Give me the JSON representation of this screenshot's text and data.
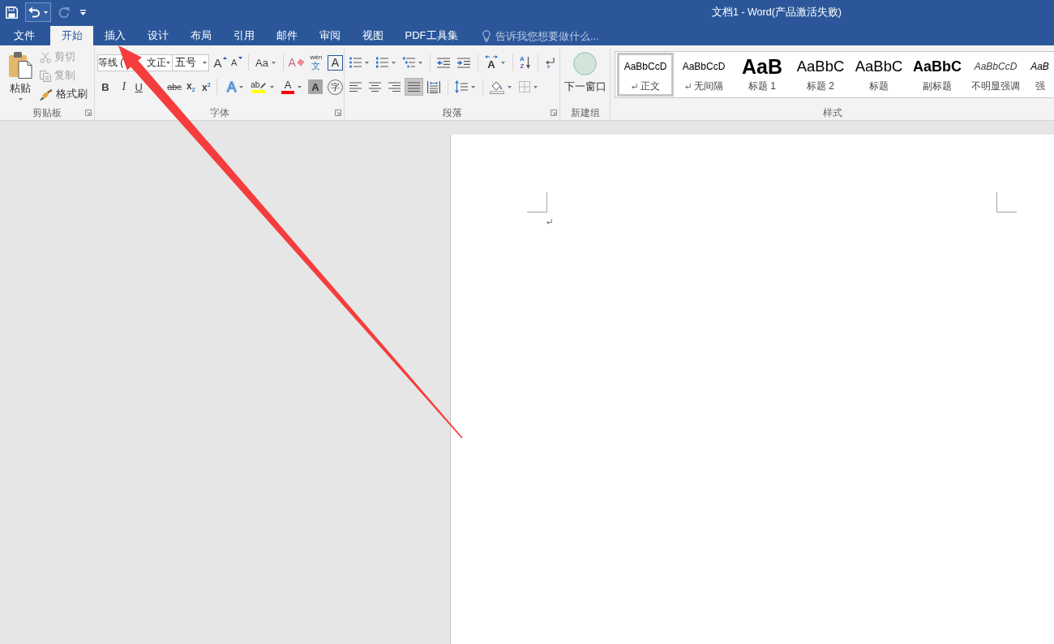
{
  "title_bar": {
    "title": "文档1 - Word(产品激活失败)",
    "quick_access": [
      {
        "kind": "save",
        "disabled": false,
        "highlighted": false,
        "dropdown": false
      },
      {
        "kind": "undo",
        "disabled": false,
        "highlighted": true,
        "dropdown": true
      },
      {
        "kind": "redo",
        "disabled": true,
        "highlighted": false,
        "dropdown": false
      },
      {
        "kind": "customize",
        "disabled": false,
        "highlighted": false,
        "dropdown": false
      }
    ]
  },
  "tabs": [
    {
      "label": "文件",
      "selected": false
    },
    {
      "label": "开始",
      "selected": true
    },
    {
      "label": "插入",
      "selected": false
    },
    {
      "label": "设计",
      "selected": false
    },
    {
      "label": "布局",
      "selected": false
    },
    {
      "label": "引用",
      "selected": false
    },
    {
      "label": "邮件",
      "selected": false
    },
    {
      "label": "审阅",
      "selected": false
    },
    {
      "label": "视图",
      "selected": false
    },
    {
      "label": "PDF工具集",
      "selected": false
    }
  ],
  "tell_me": {
    "placeholder": "告诉我您想要做什么..."
  },
  "ribbon": {
    "clipboard": {
      "label": "剪贴板",
      "launcher": true,
      "paste": {
        "label": "粘贴",
        "dropdown": true
      },
      "items": [
        {
          "kind": "cut",
          "label": "剪切",
          "disabled": true
        },
        {
          "kind": "copy",
          "label": "复制",
          "disabled": true
        },
        {
          "kind": "format_painter",
          "label": "格式刷",
          "disabled": false
        }
      ]
    },
    "font": {
      "label": "字体",
      "launcher": true,
      "font_name": {
        "value_parts": [
          "等线 (",
          "文正"
        ]
      },
      "font_size": {
        "value": "五号"
      },
      "row1": [
        [
          {
            "kind": "grow",
            "glyph": "A",
            "dropdown": false
          },
          {
            "kind": "shrink",
            "glyph": "A",
            "dropdown": false
          }
        ],
        [
          {
            "kind": "case",
            "glyph": "Aa",
            "dropdown": true
          }
        ],
        [
          {
            "kind": "clear",
            "glyph": "A",
            "dropdown": false
          },
          {
            "kind": "phonetic",
            "glyph": "wén",
            "glyph2": "文",
            "dropdown": false
          },
          {
            "kind": "border",
            "glyph": "A",
            "dropdown": false
          }
        ]
      ],
      "row2": [
        [
          {
            "kind": "bold",
            "glyph": "B",
            "dropdown": false
          },
          {
            "kind": "italic",
            "glyph": "I",
            "dropdown": false
          },
          {
            "kind": "underline",
            "glyph": "U",
            "dropdown": false
          },
          {
            "kind": "strikethrough",
            "glyph": "abc",
            "dropdown": false
          },
          {
            "kind": "subscript",
            "glyph": "x$_{2}$",
            "dropdown": false
          },
          {
            "kind": "superscript",
            "glyph": "x$^{2}$",
            "dropdown": false
          }
        ],
        [
          {
            "kind": "effects",
            "glyph": "A",
            "dropdown": true
          },
          {
            "kind": "highlight",
            "glyph": "ab",
            "color": "#ffff00",
            "dropdown": true
          },
          {
            "kind": "font_color",
            "glyph": "A",
            "color": "#ff0000",
            "dropdown": true
          },
          {
            "kind": "shading",
            "glyph": "A",
            "dropdown": false
          },
          {
            "kind": "enclosed",
            "glyph": "字",
            "dropdown": false
          }
        ]
      ]
    },
    "paragraph": {
      "label": "段落",
      "launcher": true,
      "row1": [
        [
          {
            "kind": "bullets",
            "dropdown": true
          },
          {
            "kind": "numbering",
            "dropdown": true
          },
          {
            "kind": "multilevel",
            "dropdown": true
          }
        ],
        [
          {
            "kind": "decrease_indent",
            "dropdown": false
          },
          {
            "kind": "increase_indent",
            "dropdown": false
          }
        ],
        [
          {
            "kind": "asian_layout",
            "glyph": "A",
            "dropdown": true
          }
        ],
        [
          {
            "kind": "sort",
            "glyph": "A",
            "glyph2": "Z",
            "dropdown": false
          }
        ],
        [
          {
            "kind": "show_marks",
            "dropdown": false
          }
        ]
      ],
      "row2": [
        [
          {
            "kind": "align_left",
            "selected": false,
            "dropdown": false
          },
          {
            "kind": "align_center",
            "selected": false,
            "dropdown": false
          },
          {
            "kind": "align_right",
            "selected": false,
            "dropdown": false
          },
          {
            "kind": "justify",
            "selected": true,
            "dropdown": false
          },
          {
            "kind": "distributed",
            "selected": false,
            "dropdown": false
          }
        ],
        [
          {
            "kind": "line_spacing",
            "dropdown": true
          }
        ],
        [
          {
            "kind": "para_shading",
            "dropdown": true
          },
          {
            "kind": "borders",
            "dropdown": true
          }
        ]
      ]
    },
    "new_group": {
      "label": "新建组",
      "launcher": false,
      "button": {
        "label": "下一窗口"
      }
    },
    "styles": {
      "label": "样式",
      "launcher": false,
      "items": [
        {
          "kind": "normal",
          "preview": "AaBbCcD",
          "label": "正文",
          "paragraph_mark": true,
          "selected": true
        },
        {
          "kind": "normal",
          "preview": "AaBbCcD",
          "label": "无间隔",
          "paragraph_mark": true,
          "selected": false
        },
        {
          "kind": "heading1",
          "preview": "AaB",
          "label": "标题 1",
          "paragraph_mark": false,
          "selected": false
        },
        {
          "kind": "heading2",
          "preview": "AaBbC",
          "label": "标题 2",
          "paragraph_mark": false,
          "selected": false
        },
        {
          "kind": "title",
          "preview": "AaBbC",
          "label": "标题",
          "paragraph_mark": false,
          "selected": false
        },
        {
          "kind": "subtitle",
          "preview": "AaBbC",
          "label": "副标题",
          "paragraph_mark": false,
          "selected": false
        },
        {
          "kind": "subtle_emphasis",
          "preview": "AaBbCcD",
          "label": "不明显强调",
          "paragraph_mark": false,
          "selected": false
        },
        {
          "kind": "emphasis",
          "preview": "AaB",
          "label": "强",
          "paragraph_mark": false,
          "selected": false
        }
      ]
    }
  }
}
